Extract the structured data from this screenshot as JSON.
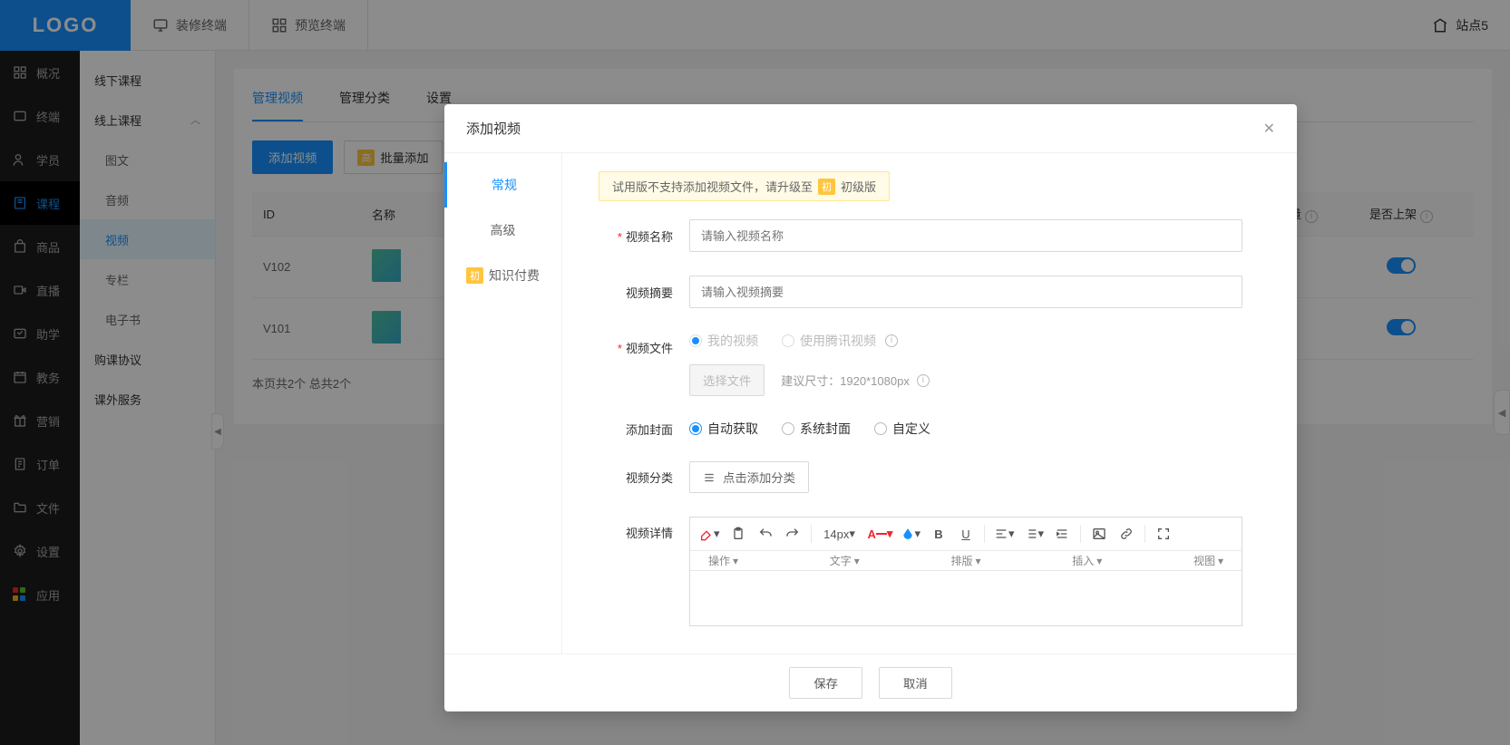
{
  "header": {
    "logo": "LOGO",
    "nav1": "装修终端",
    "nav2": "预览终端",
    "site": "站点5"
  },
  "sidebar": {
    "items": [
      {
        "label": "概况"
      },
      {
        "label": "终端"
      },
      {
        "label": "学员"
      },
      {
        "label": "课程"
      },
      {
        "label": "商品"
      },
      {
        "label": "直播"
      },
      {
        "label": "助学"
      },
      {
        "label": "教务"
      },
      {
        "label": "营销"
      },
      {
        "label": "订单"
      },
      {
        "label": "文件"
      },
      {
        "label": "设置"
      },
      {
        "label": "应用"
      }
    ]
  },
  "subsidebar": {
    "offline": "线下课程",
    "online": "线上课程",
    "children": [
      {
        "label": "图文"
      },
      {
        "label": "音频"
      },
      {
        "label": "视频"
      },
      {
        "label": "专栏"
      },
      {
        "label": "电子书"
      }
    ],
    "agreement": "购课协议",
    "extra": "课外服务"
  },
  "main": {
    "tabs": [
      {
        "label": "管理视频"
      },
      {
        "label": "管理分类"
      },
      {
        "label": "设置"
      }
    ],
    "add_btn": "添加视频",
    "batch_btn": "批量添加",
    "batch_badge": "高",
    "columns": {
      "id": "ID",
      "name": "名称",
      "qty": "量",
      "listed": "是否上架"
    },
    "rows": [
      {
        "id": "V102"
      },
      {
        "id": "V101"
      }
    ],
    "pagination": "本页共2个 总共2个"
  },
  "modal": {
    "title": "添加视频",
    "side": [
      {
        "label": "常规"
      },
      {
        "label": "高级"
      },
      {
        "label": "知识付费",
        "badge": "初"
      }
    ],
    "alert_pre": "试用版不支持添加视频文件，请升级至",
    "alert_badge": "初",
    "alert_post": "初级版",
    "fields": {
      "name_label": "视频名称",
      "name_placeholder": "请输入视频名称",
      "summary_label": "视频摘要",
      "summary_placeholder": "请输入视频摘要",
      "file_label": "视频文件",
      "file_opt1": "我的视频",
      "file_opt2": "使用腾讯视频",
      "choose_file": "选择文件",
      "size_hint": "建议尺寸：1920*1080px",
      "cover_label": "添加封面",
      "cover_opt1": "自动获取",
      "cover_opt2": "系统封面",
      "cover_opt3": "自定义",
      "category_label": "视频分类",
      "category_btn": "点击添加分类",
      "detail_label": "视频详情",
      "font_size": "14px",
      "group_action": "操作",
      "group_text": "文字",
      "group_layout": "排版",
      "group_insert": "插入",
      "group_view": "视图"
    },
    "save": "保存",
    "cancel": "取消"
  }
}
